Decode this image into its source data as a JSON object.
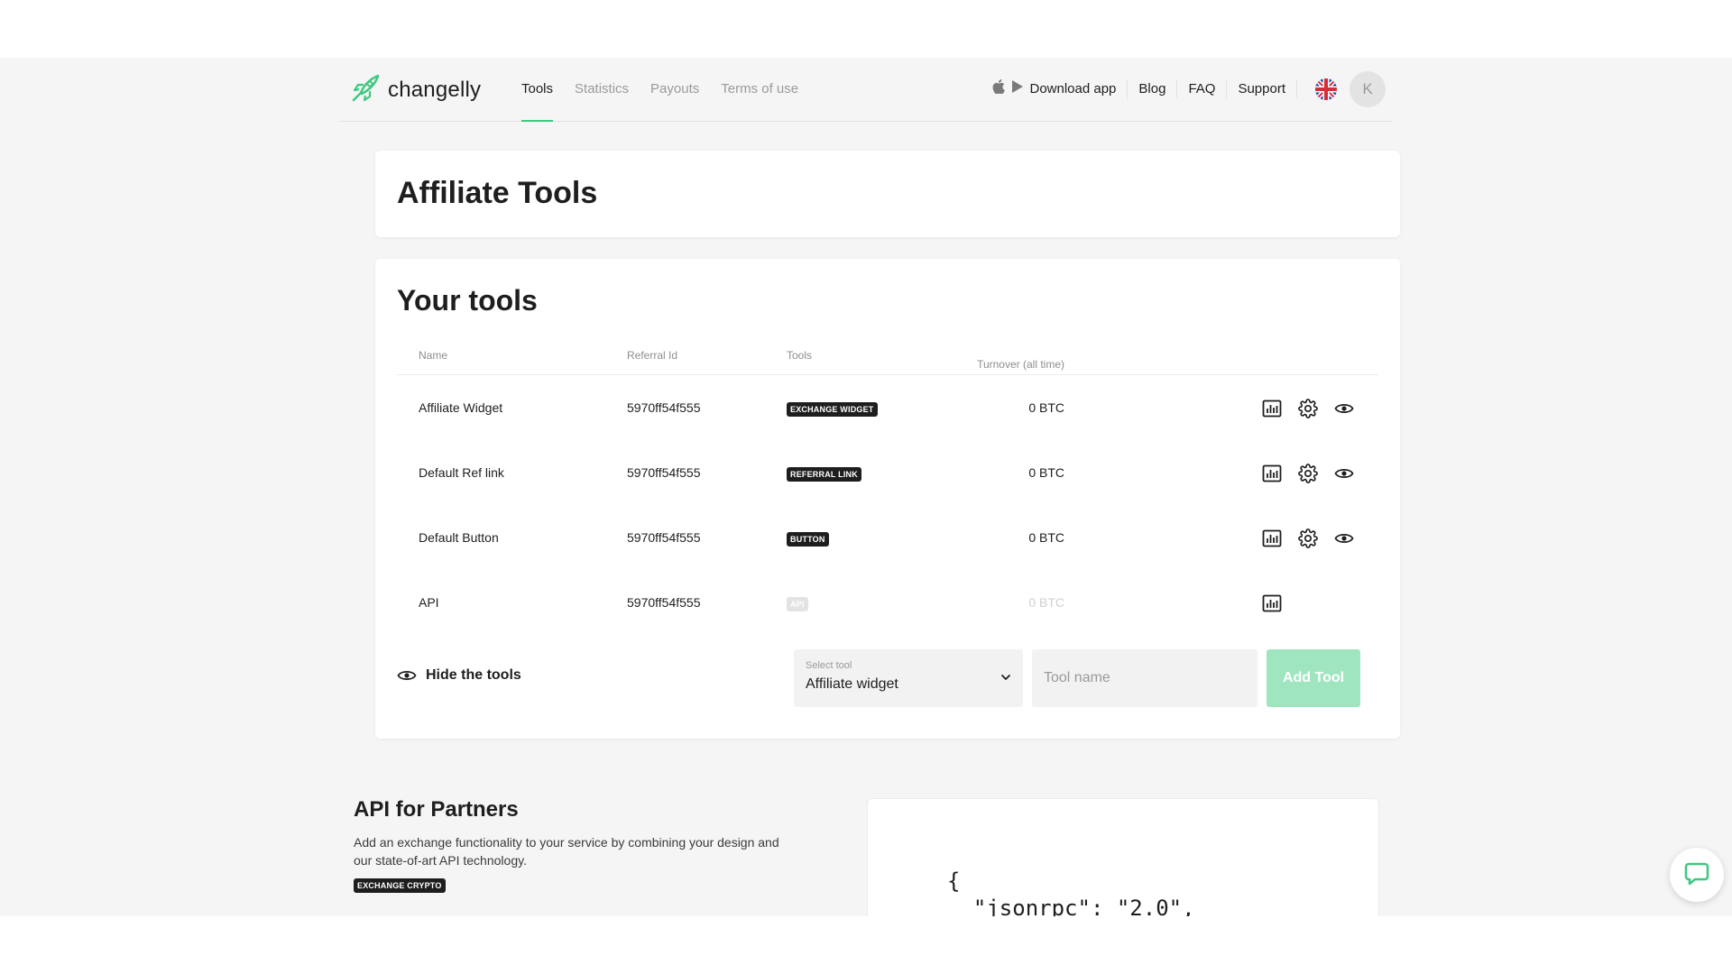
{
  "header": {
    "logo_text": "changelly",
    "nav": [
      {
        "label": "Tools",
        "active": true
      },
      {
        "label": "Statistics",
        "active": false
      },
      {
        "label": "Payouts",
        "active": false
      },
      {
        "label": "Terms of use",
        "active": false
      }
    ],
    "right": {
      "download_label": "Download app",
      "blog_label": "Blog",
      "faq_label": "FAQ",
      "support_label": "Support",
      "avatar_initial": "K"
    }
  },
  "title_card": {
    "title": "Affiliate Tools"
  },
  "tools_card": {
    "title": "Your tools",
    "columns": {
      "name": "Name",
      "referral_id": "Referral Id",
      "tools": "Tools",
      "turnover": "Turnover (all time)"
    },
    "rows": [
      {
        "name": "Affiliate Widget",
        "referral_id": "5970ff54f555",
        "tool": "EXCHANGE WIDGET",
        "turnover": "0 BTC",
        "disabled": false
      },
      {
        "name": "Default Ref link",
        "referral_id": "5970ff54f555",
        "tool": "REFERRAL LINK",
        "turnover": "0 BTC",
        "disabled": false
      },
      {
        "name": "Default Button",
        "referral_id": "5970ff54f555",
        "tool": "BUTTON",
        "turnover": "0 BTC",
        "disabled": false
      },
      {
        "name": "API",
        "referral_id": "5970ff54f555",
        "tool": "API",
        "turnover": "0 BTC",
        "disabled": true
      }
    ],
    "controls": {
      "hide_label": "Hide the tools",
      "select_label": "Select tool",
      "select_value": "Affiliate widget",
      "tool_name_placeholder": "Tool name",
      "add_button": "Add Tool"
    }
  },
  "api_section": {
    "title": "API for Partners",
    "description": "Add an exchange functionality to your service by combining your design and our state-of-art API technology.",
    "badge": "EXCHANGE CRYPTO",
    "code": "{\n  \"jsonrpc\": \"2.0\","
  },
  "colors": {
    "accent": "#3fc881",
    "add_button_bg": "#9fe6c0",
    "badge_bg": "#1e1e1e",
    "page_bg": "#f5f5f5"
  }
}
